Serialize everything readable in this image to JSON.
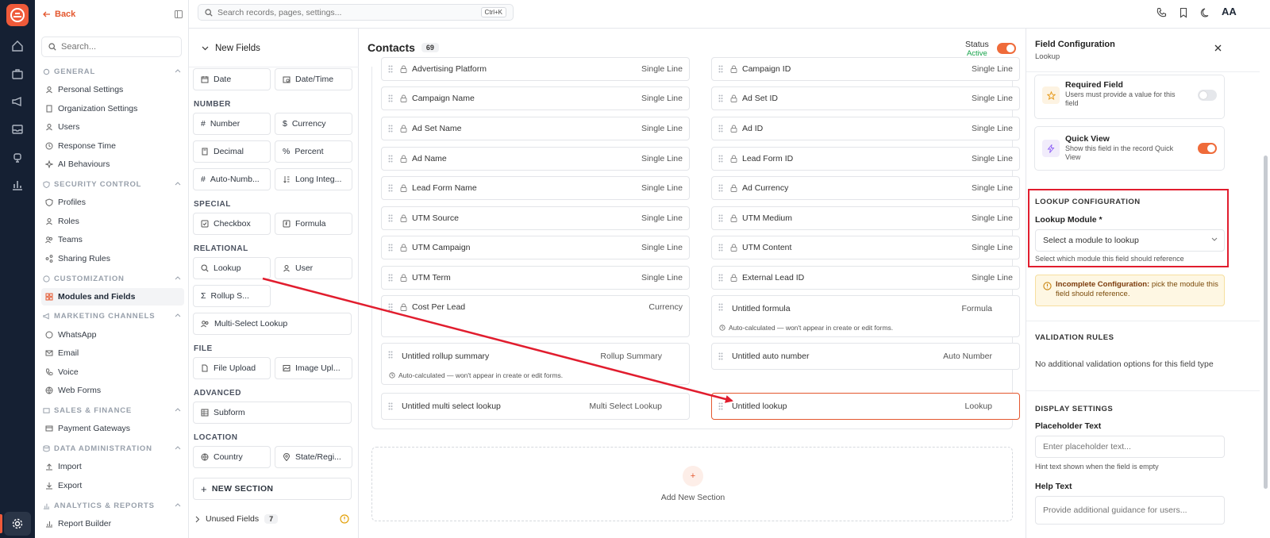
{
  "sidebar": {
    "back_label": "Back",
    "search_placeholder": "Search...",
    "sections": [
      {
        "title": "GENERAL",
        "items": [
          "Personal Settings",
          "Organization Settings",
          "Users",
          "Response Time",
          "AI Behaviours"
        ]
      },
      {
        "title": "SECURITY CONTROL",
        "items": [
          "Profiles",
          "Roles",
          "Teams",
          "Sharing Rules"
        ]
      },
      {
        "title": "CUSTOMIZATION",
        "items": [
          "Modules and Fields"
        ]
      },
      {
        "title": "MARKETING CHANNELS",
        "items": [
          "WhatsApp",
          "Email",
          "Voice",
          "Web Forms"
        ]
      },
      {
        "title": "SALES & FINANCE",
        "items": [
          "Payment Gateways"
        ]
      },
      {
        "title": "DATA ADMINISTRATION",
        "items": [
          "Import",
          "Export"
        ]
      },
      {
        "title": "ANALYTICS & REPORTS",
        "items": [
          "Report Builder"
        ]
      }
    ],
    "active_item": "Modules and Fields"
  },
  "topbar": {
    "search_placeholder": "Search records, pages, settings...",
    "shortcut": "Ctrl+K",
    "avatar": "AA"
  },
  "palette": {
    "header": "New Fields",
    "top_row": [
      "Date",
      "Date/Time"
    ],
    "categories": {
      "number": {
        "title": "NUMBER",
        "fields": [
          "Number",
          "Currency",
          "Decimal",
          "Percent",
          "Auto-Numb...",
          "Long Integ..."
        ]
      },
      "special": {
        "title": "SPECIAL",
        "fields": [
          "Checkbox",
          "Formula"
        ]
      },
      "relational": {
        "title": "RELATIONAL",
        "fields": [
          "Lookup",
          "User",
          "Rollup S...",
          "Multi-Select Lookup"
        ]
      },
      "file": {
        "title": "FILE",
        "fields": [
          "File Upload",
          "Image Upl..."
        ]
      },
      "advanced": {
        "title": "ADVANCED",
        "fields": [
          "Subform"
        ]
      },
      "location": {
        "title": "LOCATION",
        "fields": [
          "Country",
          "State/Regi..."
        ]
      }
    },
    "new_section": "NEW SECTION",
    "unused_label": "Unused Fields",
    "unused_count": "7"
  },
  "canvas": {
    "title": "Contacts",
    "count": "69",
    "status_label": "Status",
    "status_value": "Active",
    "left_fields": [
      {
        "name": "Advertising Platform",
        "type": "Single Line"
      },
      {
        "name": "Campaign Name",
        "type": "Single Line"
      },
      {
        "name": "Ad Set Name",
        "type": "Single Line"
      },
      {
        "name": "Ad Name",
        "type": "Single Line"
      },
      {
        "name": "Lead Form Name",
        "type": "Single Line"
      },
      {
        "name": "UTM Source",
        "type": "Single Line"
      },
      {
        "name": "UTM Campaign",
        "type": "Single Line"
      },
      {
        "name": "UTM Term",
        "type": "Single Line"
      },
      {
        "name": "Cost Per Lead",
        "type": "Currency"
      }
    ],
    "right_fields": [
      {
        "name": "Campaign ID",
        "type": "Single Line"
      },
      {
        "name": "Ad Set ID",
        "type": "Single Line"
      },
      {
        "name": "Ad ID",
        "type": "Single Line"
      },
      {
        "name": "Lead Form ID",
        "type": "Single Line"
      },
      {
        "name": "Ad Currency",
        "type": "Single Line"
      },
      {
        "name": "UTM Medium",
        "type": "Single Line"
      },
      {
        "name": "UTM Content",
        "type": "Single Line"
      },
      {
        "name": "External Lead ID",
        "type": "Single Line"
      }
    ],
    "formula_field": {
      "name": "Untitled formula",
      "type": "Formula",
      "hint": "Auto-calculated — won't appear in create or edit forms."
    },
    "rollup_field": {
      "name": "Untitled rollup summary",
      "type": "Rollup Summary",
      "hint": "Auto-calculated — won't appear in create or edit forms."
    },
    "autonumber_field": {
      "name": "Untitled auto number",
      "type": "Auto Number"
    },
    "multilookup_field": {
      "name": "Untitled multi select lookup",
      "type": "Multi Select Lookup"
    },
    "lookup_field": {
      "name": "Untitled lookup",
      "type": "Lookup"
    },
    "add_section": "Add New Section"
  },
  "config": {
    "title": "Field Configuration",
    "subtitle": "Lookup",
    "required": {
      "title": "Required Field",
      "desc": "Users must provide a value for this field",
      "on": false
    },
    "quickview": {
      "title": "Quick View",
      "desc": "Show this field in the record Quick View",
      "on": true
    },
    "lookup_heading": "LOOKUP CONFIGURATION",
    "lookup_module_label": "Lookup Module *",
    "lookup_module_placeholder": "Select a module to lookup",
    "lookup_help": "Select which module this field should reference",
    "warning_bold": "Incomplete Configuration:",
    "warning_text": " pick the module this field should reference.",
    "validation_heading": "VALIDATION RULES",
    "validation_text": "No additional validation options for this field type",
    "display_heading": "DISPLAY SETTINGS",
    "placeholder_label": "Placeholder Text",
    "placeholder_input": "Enter placeholder text...",
    "placeholder_help": "Hint text shown when the field is empty",
    "help_label": "Help Text",
    "help_input": "Provide additional guidance for users..."
  },
  "colors": {
    "accent": "#e4572e",
    "rail": "#152033",
    "highlight": "#e11d2e"
  }
}
